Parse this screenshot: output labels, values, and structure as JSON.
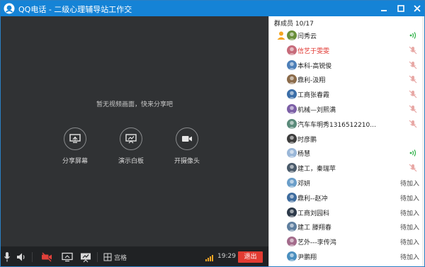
{
  "window": {
    "title": "QQ电话 - 二级心理辅导站工作交",
    "accent": "#1583d6"
  },
  "video": {
    "no_video_text": "暂无视频画面，快来分享吧",
    "actions": [
      {
        "label": "分享屏幕",
        "icon": "share-screen-icon"
      },
      {
        "label": "演示白板",
        "icon": "whiteboard-icon"
      },
      {
        "label": "开摄像头",
        "icon": "camera-icon"
      }
    ]
  },
  "toolbar": {
    "layout_label": "宫格",
    "time": "19:29",
    "exit_label": "退出",
    "exit_color": "#e23b32"
  },
  "members": {
    "header": "群成员 10/17",
    "list": [
      {
        "name": "闫秀云",
        "status": "speaking",
        "admin": true
      },
      {
        "name": "信艺于雯雯",
        "status": "muted",
        "host": true
      },
      {
        "name": "本科-高锐俊",
        "status": "muted"
      },
      {
        "name": "鼎利-汲翔",
        "status": "muted"
      },
      {
        "name": "工商张春霞",
        "status": "muted"
      },
      {
        "name": "机械—刘熙满",
        "status": "muted"
      },
      {
        "name": "汽车车明秀1316512210...",
        "status": "muted"
      },
      {
        "name": "时彦鹏",
        "status": "none"
      },
      {
        "name": "杨慧",
        "status": "speaking"
      },
      {
        "name": "建工，秦瑞苹",
        "status": "muted"
      },
      {
        "name": "邓妍",
        "status": "pending"
      },
      {
        "name": "鼎利--赵冲",
        "status": "pending"
      },
      {
        "name": "工商刘园科",
        "status": "pending"
      },
      {
        "name": "建工 滕翔春",
        "status": "pending"
      },
      {
        "name": "艺外---李传鸿",
        "status": "pending"
      },
      {
        "name": "尹鹏翔",
        "status": "pending"
      }
    ],
    "pending_label": "待加入"
  }
}
